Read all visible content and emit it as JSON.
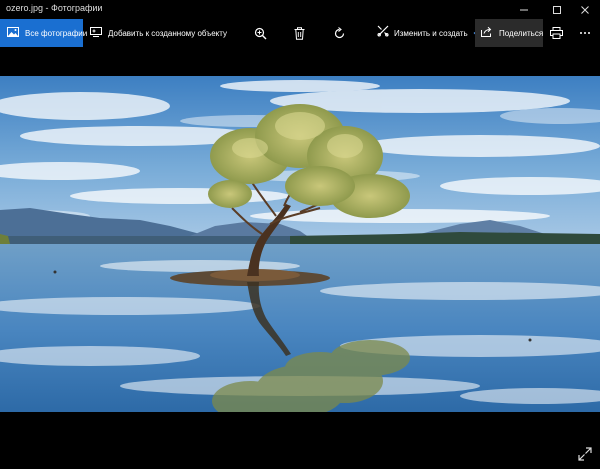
{
  "window": {
    "title": "ozero.jpg - Фотографии",
    "controls": [
      "minimize",
      "maximize",
      "close"
    ]
  },
  "toolbar": {
    "all_photos_label": "Все фотографии",
    "add_to_creation_label": "Добавить к созданному объекту",
    "change_create_label": "Изменить и создать",
    "share_label": "Поделиться",
    "icons": [
      "photos-icon",
      "add-to-creation-icon",
      "zoom-icon",
      "delete-icon",
      "rotate-icon",
      "edit-icon",
      "chevron-down-icon",
      "share-icon",
      "print-icon",
      "more-icon"
    ]
  },
  "viewer": {
    "image_subject": "lake-tree-photo",
    "fullscreen_icon": "expand-icon"
  },
  "colors": {
    "accent": "#1a6fd1",
    "background": "#000000",
    "share_highlight": "#2b2b2b"
  }
}
